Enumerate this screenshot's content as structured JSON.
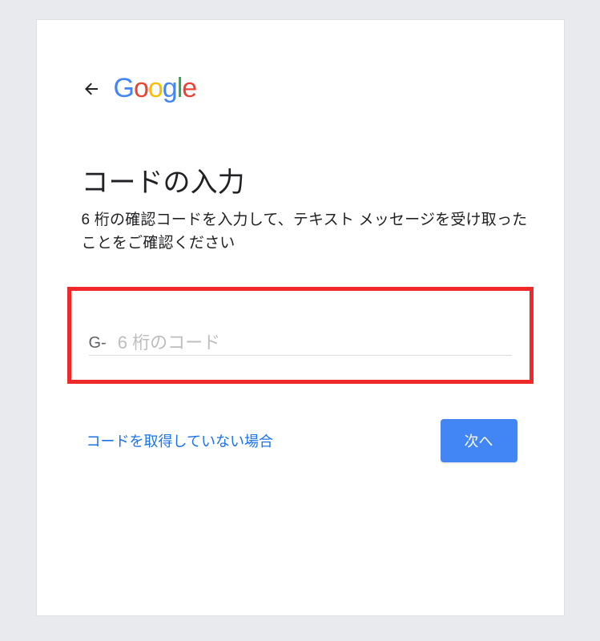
{
  "logo": {
    "text": "Google"
  },
  "heading": {
    "title": "コードの入力",
    "subtitle": "6 桁の確認コードを入力して、テキスト メッセージを受け取ったことをご確認ください"
  },
  "input": {
    "prefix": "G-",
    "placeholder": "6 桁のコード",
    "value": ""
  },
  "actions": {
    "link_label": "コードを取得していない場合",
    "next_label": "次へ"
  }
}
